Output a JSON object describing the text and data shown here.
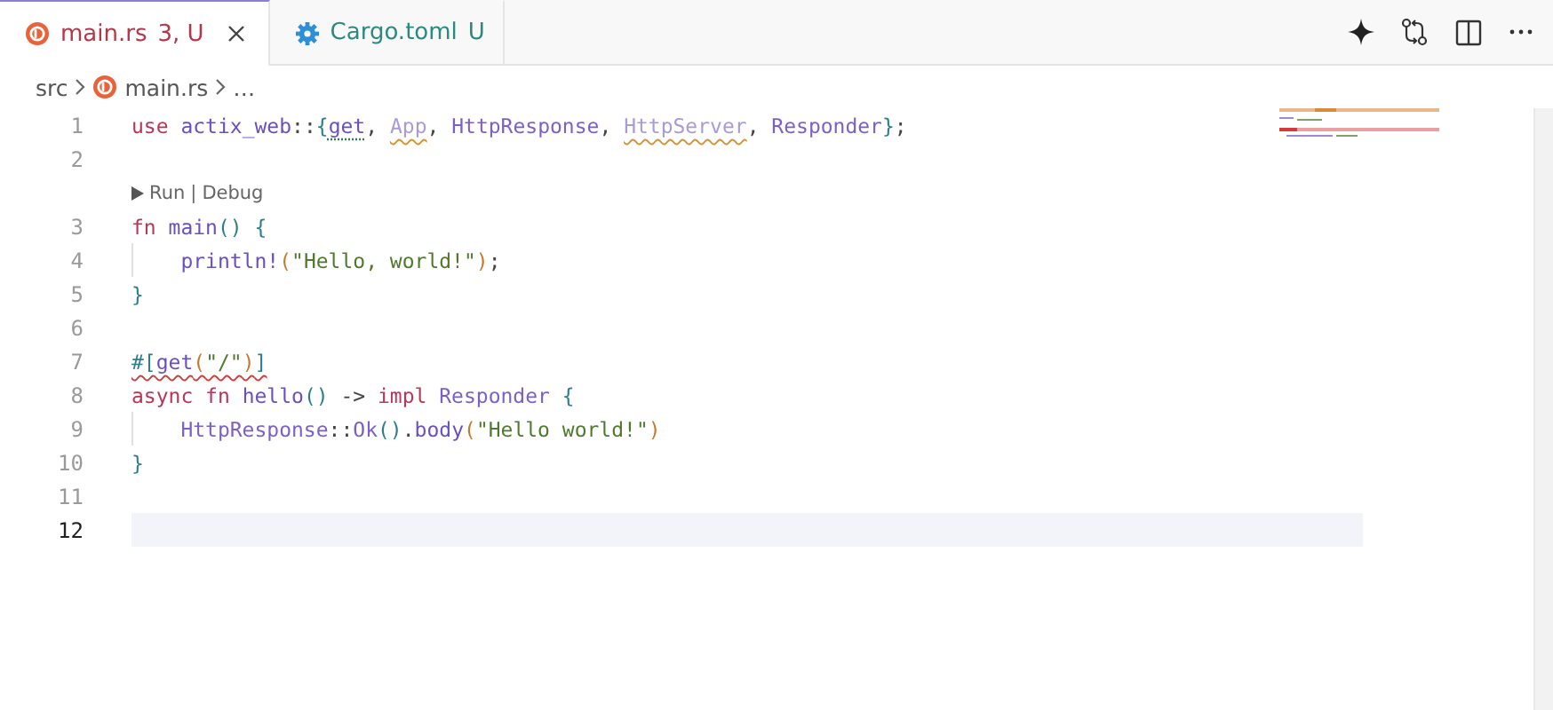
{
  "tabs": [
    {
      "label": "main.rs",
      "status": "3, U",
      "kind": "rust",
      "selected": true,
      "closable": true
    },
    {
      "label": "Cargo.toml",
      "status": "U",
      "kind": "config",
      "selected": false,
      "closable": false
    }
  ],
  "breadcrumb": [
    "src",
    "main.rs",
    "…"
  ],
  "lines": [
    {
      "number": "1",
      "current": false,
      "indent_guide": false,
      "tokens": [
        {
          "text": "use",
          "kind": "keyword"
        },
        {
          "text": " actix_web",
          "kind": "module"
        },
        {
          "text": "::",
          "kind": "punct"
        },
        {
          "text": "{",
          "kind": "brace"
        },
        {
          "text": "get",
          "kind": "module",
          "hint": true
        },
        {
          "text": ", ",
          "kind": "punct"
        },
        {
          "text": "App",
          "kind": "unused",
          "warning": true
        },
        {
          "text": ", ",
          "kind": "punct"
        },
        {
          "text": "HttpResponse",
          "kind": "type"
        },
        {
          "text": ", ",
          "kind": "punct"
        },
        {
          "text": "HttpServer",
          "kind": "unused",
          "warning": true
        },
        {
          "text": ", ",
          "kind": "punct"
        },
        {
          "text": "Responder",
          "kind": "type"
        },
        {
          "text": "}",
          "kind": "brace"
        },
        {
          "text": ";",
          "kind": "punct"
        }
      ]
    },
    {
      "number": "2",
      "current": false,
      "indent_guide": false,
      "codelens": {
        "items": [
          "Run",
          "Debug"
        ],
        "separator": "|"
      }
    },
    {
      "number": "3",
      "current": false,
      "indent_guide": false,
      "tokens": [
        {
          "text": "fn",
          "kind": "keyword"
        },
        {
          "text": " main",
          "kind": "module"
        },
        {
          "text": "()",
          "kind": "brace"
        },
        {
          "text": " {",
          "kind": "brace"
        }
      ]
    },
    {
      "number": "4",
      "current": false,
      "indent_guide": true,
      "tokens": [
        {
          "text": "    println!",
          "kind": "module"
        },
        {
          "text": "(",
          "kind": "paren"
        },
        {
          "text": "\"Hello, world!\"",
          "kind": "string"
        },
        {
          "text": ")",
          "kind": "paren"
        },
        {
          "text": ";",
          "kind": "punct"
        }
      ]
    },
    {
      "number": "5",
      "current": false,
      "indent_guide": false,
      "tokens": [
        {
          "text": "}",
          "kind": "brace"
        }
      ]
    },
    {
      "number": "6",
      "current": false,
      "indent_guide": false
    },
    {
      "number": "7",
      "current": false,
      "indent_guide": false,
      "tokens": [
        {
          "text": "#[",
          "kind": "brace",
          "error": true
        },
        {
          "text": "get",
          "kind": "module",
          "error": true
        },
        {
          "text": "(",
          "kind": "paren",
          "error": true
        },
        {
          "text": "\"/\"",
          "kind": "string",
          "error": true
        },
        {
          "text": ")",
          "kind": "paren",
          "error": true
        },
        {
          "text": "]",
          "kind": "brace",
          "error": true
        }
      ]
    },
    {
      "number": "8",
      "current": false,
      "indent_guide": false,
      "tokens": [
        {
          "text": "async fn",
          "kind": "keyword"
        },
        {
          "text": " hello",
          "kind": "module"
        },
        {
          "text": "()",
          "kind": "brace"
        },
        {
          "text": " -> ",
          "kind": "punct"
        },
        {
          "text": "impl",
          "kind": "keyword"
        },
        {
          "text": " Responder",
          "kind": "type"
        },
        {
          "text": " {",
          "kind": "brace"
        }
      ]
    },
    {
      "number": "9",
      "current": false,
      "indent_guide": true,
      "tokens": [
        {
          "text": "    HttpResponse",
          "kind": "type"
        },
        {
          "text": "::",
          "kind": "punct"
        },
        {
          "text": "Ok",
          "kind": "type"
        },
        {
          "text": "()",
          "kind": "brace"
        },
        {
          "text": ".",
          "kind": "punct"
        },
        {
          "text": "body",
          "kind": "module"
        },
        {
          "text": "(",
          "kind": "paren"
        },
        {
          "text": "\"Hello world!\"",
          "kind": "string"
        },
        {
          "text": ")",
          "kind": "paren"
        }
      ]
    },
    {
      "number": "10",
      "current": false,
      "indent_guide": false,
      "tokens": [
        {
          "text": "}",
          "kind": "brace"
        }
      ]
    },
    {
      "number": "11",
      "current": false,
      "indent_guide": false
    },
    {
      "number": "12",
      "current": true,
      "indent_guide": false
    }
  ]
}
